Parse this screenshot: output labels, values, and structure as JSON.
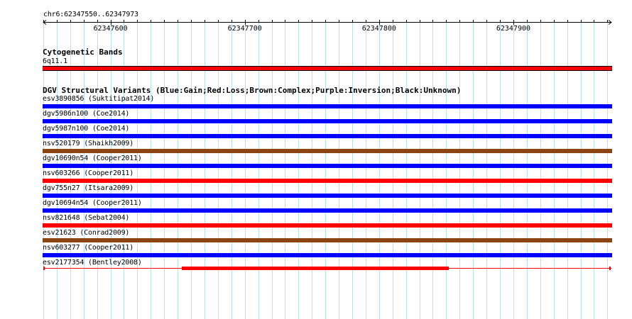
{
  "ruler": {
    "region": "chr6:62347550..62347973",
    "start": 62347550,
    "end": 62347973,
    "ticks": [
      "62347600",
      "62347700",
      "62347800",
      "62347900"
    ]
  },
  "cytoband": {
    "section_title": "Cytogenetic Bands",
    "band_label": "6q11.1",
    "color": "#ff0000"
  },
  "dgv": {
    "section_title": "DGV Structural Variants (Blue:Gain;Red:Loss;Brown:Complex;Purple:Inversion;Black:Unknown)",
    "colors": {
      "gain": "#0000ff",
      "loss": "#ff0000",
      "complex": "#8b4513"
    },
    "variants": [
      {
        "label": "esv3890856 (Suktitipat2014)",
        "type": "gain"
      },
      {
        "label": "dgv5986n100 (Coe2014)",
        "type": "gain"
      },
      {
        "label": "dgv5987n100 (Coe2014)",
        "type": "gain"
      },
      {
        "label": "nsv520179 (Shaikh2009)",
        "type": "complex"
      },
      {
        "label": "dgv10690n54 (Cooper2011)",
        "type": "gain"
      },
      {
        "label": "nsv603266 (Cooper2011)",
        "type": "loss"
      },
      {
        "label": "dgv755n27 (Itsara2009)",
        "type": "gain"
      },
      {
        "label": "dgv10694n54 (Cooper2011)",
        "type": "gain"
      },
      {
        "label": "nsv821648 (Sebat2004)",
        "type": "loss"
      },
      {
        "label": "esv21623 (Conrad2009)",
        "type": "complex"
      },
      {
        "label": "nsv603277 (Cooper2011)",
        "type": "gain"
      },
      {
        "label": "esv2177354 (Bentley2008)",
        "type": "loss",
        "style": "split",
        "core_start": 62347653,
        "core_end": 62347852
      }
    ]
  }
}
